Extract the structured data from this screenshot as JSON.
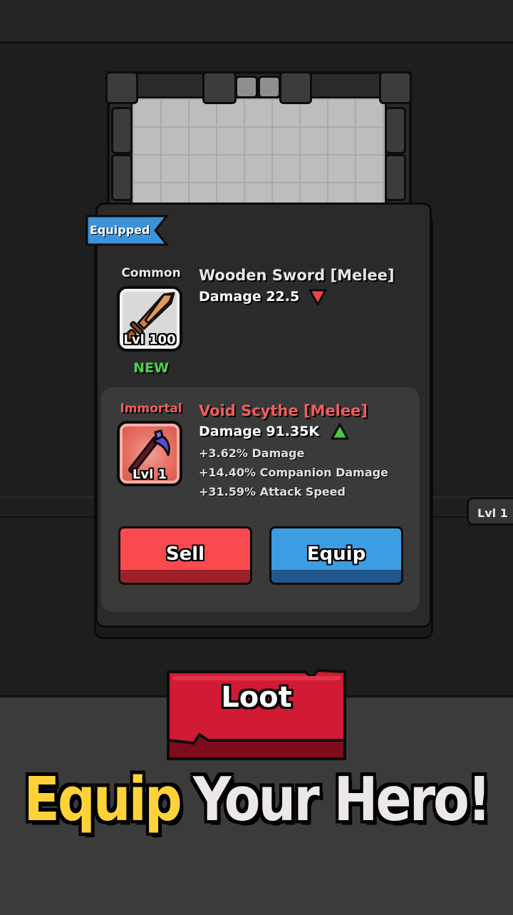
{
  "equipped_badge": "Equipped",
  "equipped_item": {
    "rarity": "Common",
    "name": "Wooden Sword [Melee]",
    "damage": "Damage 22.5",
    "level": "Lvl 100",
    "new_tag": "NEW",
    "trend_icon": "down-arrow-icon",
    "trend_color": "#f04444"
  },
  "new_item": {
    "rarity": "Immortal",
    "name": "Void Scythe [Melee]",
    "damage": "Damage 91.35K",
    "level": "Lvl 1",
    "trend_icon": "up-arrow-icon",
    "trend_color": "#49c84b",
    "stats": [
      "+3.62% Damage",
      "+14.40% Companion Damage",
      "+31.59% Attack Speed"
    ]
  },
  "buttons": {
    "sell": "Sell",
    "equip": "Equip",
    "loot": "Loot"
  },
  "side_level": "Lvl 1",
  "tagline": {
    "part1": "Equip",
    "part2": "Your Hero!"
  },
  "colors": {
    "sell": "#fb4a4f",
    "equip": "#3d9de2",
    "loot": "#d11a33",
    "ribbon": "#3c93d8",
    "tagline_accent": "#ffd23a"
  }
}
